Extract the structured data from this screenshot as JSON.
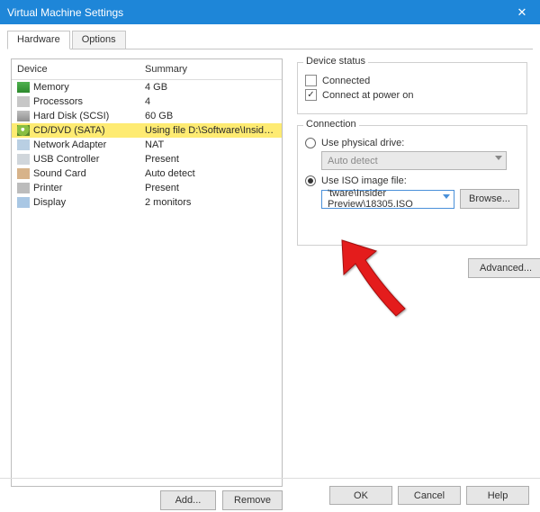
{
  "window": {
    "title": "Virtual Machine Settings"
  },
  "tabs": {
    "hardware": "Hardware",
    "options": "Options"
  },
  "deviceList": {
    "headerDevice": "Device",
    "headerSummary": "Summary",
    "rows": [
      {
        "name": "Memory",
        "summary": "4 GB"
      },
      {
        "name": "Processors",
        "summary": "4"
      },
      {
        "name": "Hard Disk (SCSI)",
        "summary": "60 GB"
      },
      {
        "name": "CD/DVD (SATA)",
        "summary": "Using file D:\\Software\\Insider ..."
      },
      {
        "name": "Network Adapter",
        "summary": "NAT"
      },
      {
        "name": "USB Controller",
        "summary": "Present"
      },
      {
        "name": "Sound Card",
        "summary": "Auto detect"
      },
      {
        "name": "Printer",
        "summary": "Present"
      },
      {
        "name": "Display",
        "summary": "2 monitors"
      }
    ]
  },
  "leftButtons": {
    "add": "Add...",
    "remove": "Remove"
  },
  "status": {
    "legend": "Device status",
    "connected": "Connected",
    "connectAtPowerOn": "Connect at power on"
  },
  "connection": {
    "legend": "Connection",
    "usePhysical": "Use physical drive:",
    "physicalValue": "Auto detect",
    "useIso": "Use ISO image file:",
    "isoValue": "'tware\\Insider Preview\\18305.ISO",
    "browse": "Browse..."
  },
  "advanced": "Advanced...",
  "dialogButtons": {
    "ok": "OK",
    "cancel": "Cancel",
    "help": "Help"
  }
}
